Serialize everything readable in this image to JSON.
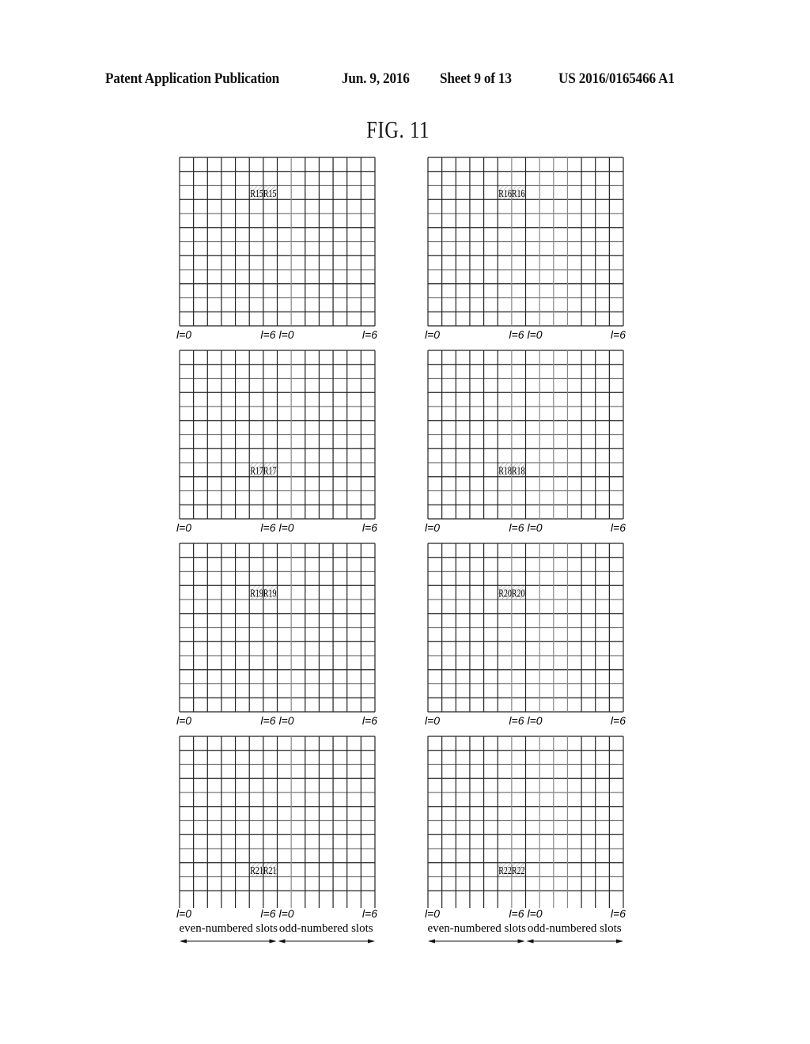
{
  "header": {
    "publication": "Patent Application Publication",
    "date": "Jun. 9, 2016",
    "sheet": "Sheet 9 of 13",
    "number": "US 2016/0165466 A1"
  },
  "figure": {
    "title": "FIG. 11",
    "grid": {
      "columns": 14,
      "rows": 12,
      "slot_boundary_column": 7
    },
    "axis_labels": {
      "first_start": "l=0",
      "first_end": "l=6",
      "second_start": "l=0",
      "second_end": "l=6"
    },
    "slot_labels": {
      "even": "even-numbered slots",
      "odd": "odd-numbered slots"
    },
    "panels": [
      {
        "id": "R15",
        "label": "R15",
        "row": 2,
        "columns": [
          5,
          6
        ],
        "position": "top-left"
      },
      {
        "id": "R16",
        "label": "R16",
        "row": 2,
        "columns": [
          5,
          6
        ],
        "position": "top-right"
      },
      {
        "id": "R17",
        "label": "R17",
        "row": 8,
        "columns": [
          5,
          6
        ],
        "position": "second-left"
      },
      {
        "id": "R18",
        "label": "R18",
        "row": 8,
        "columns": [
          5,
          6
        ],
        "position": "second-right"
      },
      {
        "id": "R19",
        "label": "R19",
        "row": 3,
        "columns": [
          5,
          6
        ],
        "position": "third-left"
      },
      {
        "id": "R20",
        "label": "R20",
        "row": 3,
        "columns": [
          5,
          6
        ],
        "position": "third-right"
      },
      {
        "id": "R21",
        "label": "R21",
        "row": 9,
        "columns": [
          5,
          6
        ],
        "position": "bottom-left"
      },
      {
        "id": "R22",
        "label": "R22",
        "row": 9,
        "columns": [
          5,
          6
        ],
        "position": "bottom-right"
      }
    ]
  }
}
